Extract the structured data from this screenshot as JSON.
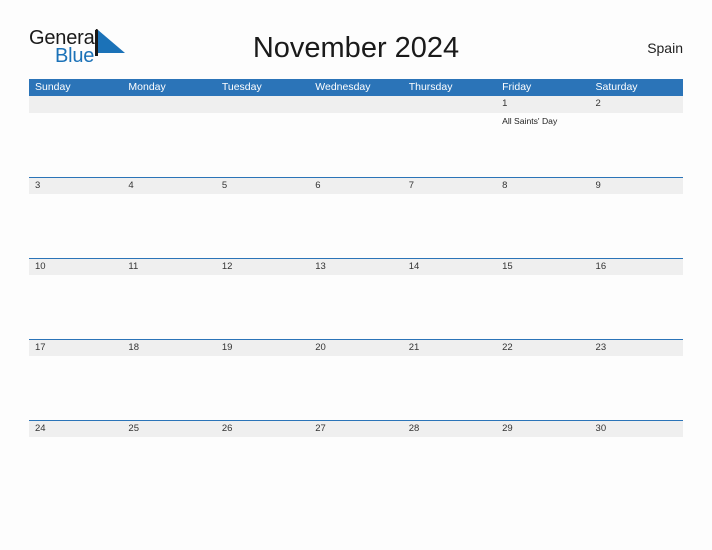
{
  "brand": {
    "name_part1": "General",
    "name_part2": "Blue",
    "color_dark": "#1a1a1a",
    "color_blue": "#1b72b8"
  },
  "header": {
    "title": "November 2024",
    "region": "Spain"
  },
  "theme": {
    "header_blue": "#2b74b8",
    "date_band_gray": "#efefef",
    "page_background": "#fdfdfd",
    "text_color": "#333333"
  },
  "calendar": {
    "month": "November",
    "year": "2024",
    "weekday_headers": [
      "Sunday",
      "Monday",
      "Tuesday",
      "Wednesday",
      "Thursday",
      "Friday",
      "Saturday"
    ],
    "weeks": [
      {
        "days": [
          {
            "number": "",
            "events": []
          },
          {
            "number": "",
            "events": []
          },
          {
            "number": "",
            "events": []
          },
          {
            "number": "",
            "events": []
          },
          {
            "number": "",
            "events": []
          },
          {
            "number": "1",
            "events": [
              "All Saints' Day"
            ]
          },
          {
            "number": "2",
            "events": []
          }
        ]
      },
      {
        "days": [
          {
            "number": "3",
            "events": []
          },
          {
            "number": "4",
            "events": []
          },
          {
            "number": "5",
            "events": []
          },
          {
            "number": "6",
            "events": []
          },
          {
            "number": "7",
            "events": []
          },
          {
            "number": "8",
            "events": []
          },
          {
            "number": "9",
            "events": []
          }
        ]
      },
      {
        "days": [
          {
            "number": "10",
            "events": []
          },
          {
            "number": "11",
            "events": []
          },
          {
            "number": "12",
            "events": []
          },
          {
            "number": "13",
            "events": []
          },
          {
            "number": "14",
            "events": []
          },
          {
            "number": "15",
            "events": []
          },
          {
            "number": "16",
            "events": []
          }
        ]
      },
      {
        "days": [
          {
            "number": "17",
            "events": []
          },
          {
            "number": "18",
            "events": []
          },
          {
            "number": "19",
            "events": []
          },
          {
            "number": "20",
            "events": []
          },
          {
            "number": "21",
            "events": []
          },
          {
            "number": "22",
            "events": []
          },
          {
            "number": "23",
            "events": []
          }
        ]
      },
      {
        "days": [
          {
            "number": "24",
            "events": []
          },
          {
            "number": "25",
            "events": []
          },
          {
            "number": "26",
            "events": []
          },
          {
            "number": "27",
            "events": []
          },
          {
            "number": "28",
            "events": []
          },
          {
            "number": "29",
            "events": []
          },
          {
            "number": "30",
            "events": []
          }
        ]
      }
    ]
  }
}
